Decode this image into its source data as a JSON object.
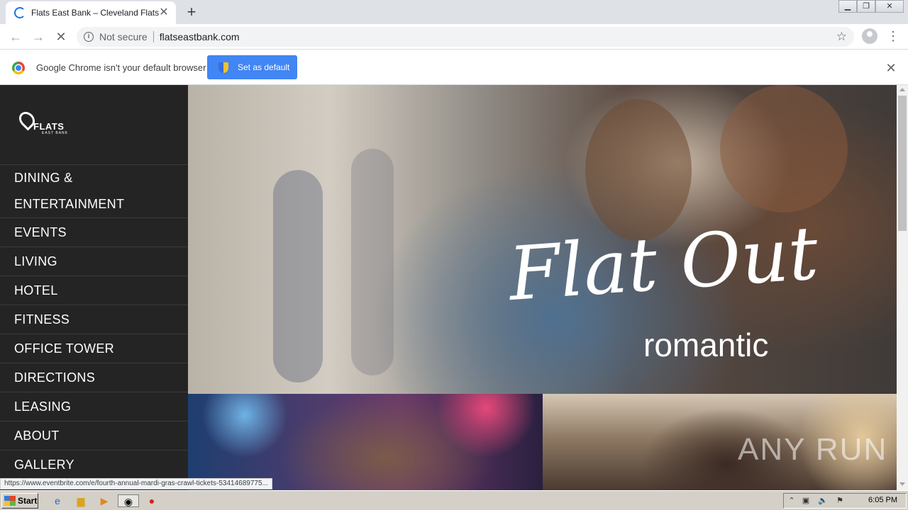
{
  "browser": {
    "tab_title": "Flats East Bank – Cleveland Flats",
    "new_tab_glyph": "+",
    "tab_close_glyph": "✕",
    "security_label": "Not secure",
    "url": "flatseastbank.com",
    "infobar_text": "Google Chrome isn't your default browser",
    "infobar_button": "Set as default",
    "status_url": "https://www.eventbrite.com/e/fourth-annual-mardi-gras-crawl-tickets-53414689775...",
    "accent_color": "#4285f4"
  },
  "site": {
    "logo_text": "FLATS",
    "logo_subtext": "EAST BANK",
    "nav": [
      {
        "label": "DINING &"
      },
      {
        "label": "ENTERTAINMENT"
      },
      {
        "label": "EVENTS"
      },
      {
        "label": "LIVING"
      },
      {
        "label": "HOTEL"
      },
      {
        "label": "FITNESS"
      },
      {
        "label": "OFFICE TOWER"
      },
      {
        "label": "DIRECTIONS"
      },
      {
        "label": "LEASING"
      },
      {
        "label": "ABOUT"
      },
      {
        "label": "GALLERY"
      }
    ],
    "hero_title": "Flat Out",
    "hero_subtitle": "romantic",
    "sidebar_color": "#242424"
  },
  "watermark": "ANY RUN",
  "taskbar": {
    "start_label": "Start",
    "clock": "6:05 PM"
  }
}
